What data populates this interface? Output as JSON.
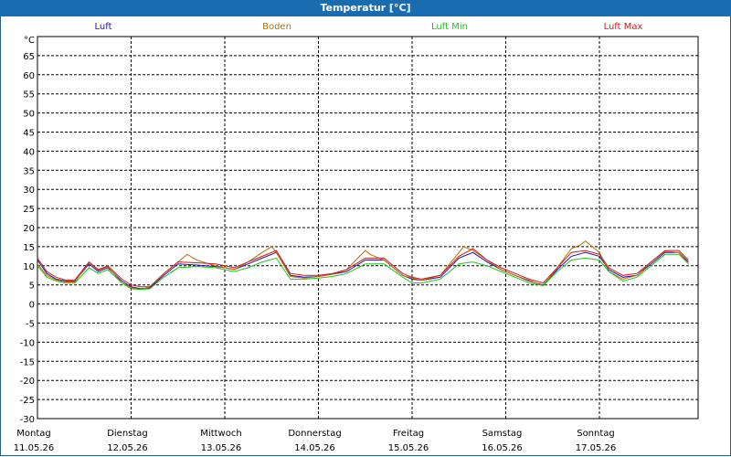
{
  "window": {
    "title": "Temperatur [°C]"
  },
  "colors": {
    "titlebar": "#1a6cb0",
    "grid": "#000000",
    "background": "#ffffff"
  },
  "chart_data": {
    "type": "line",
    "title": "Temperatur [°C]",
    "yunit": "°C",
    "ylim": [
      -30,
      70
    ],
    "yticks": [
      65,
      60,
      55,
      50,
      45,
      40,
      35,
      30,
      25,
      20,
      15,
      10,
      5,
      0,
      -5,
      -10,
      -15,
      -20,
      -25,
      -30
    ],
    "xlim": [
      0,
      7
    ],
    "grid": true,
    "legend_position": "top",
    "xticks": [
      {
        "x": 0,
        "day": "Montag",
        "date": "11.05.26"
      },
      {
        "x": 1,
        "day": "Dienstag",
        "date": "12.05.26"
      },
      {
        "x": 2,
        "day": "Mittwoch",
        "date": "13.05.26"
      },
      {
        "x": 3,
        "day": "Donnerstag",
        "date": "14.05.26"
      },
      {
        "x": 4,
        "day": "Freitag",
        "date": "15.05.26"
      },
      {
        "x": 5,
        "day": "Samstag",
        "date": "16.05.26"
      },
      {
        "x": 6,
        "day": "Sonntag",
        "date": "17.05.26"
      }
    ],
    "series": [
      {
        "name": "Luft",
        "color": "#1818a0",
        "x": [
          0,
          0.1,
          0.2,
          0.3,
          0.4,
          0.55,
          0.65,
          0.75,
          0.9,
          1.0,
          1.1,
          1.2,
          1.35,
          1.5,
          1.7,
          1.9,
          2.0,
          2.1,
          2.25,
          2.4,
          2.55,
          2.7,
          2.85,
          3.0,
          3.15,
          3.3,
          3.5,
          3.7,
          3.9,
          4.0,
          4.1,
          4.3,
          4.5,
          4.65,
          4.8,
          4.95,
          5.1,
          5.25,
          5.4,
          5.55,
          5.7,
          5.85,
          6.0,
          6.1,
          6.25,
          6.4,
          6.55,
          6.7,
          6.85,
          6.95
        ],
        "y": [
          11.5,
          8.0,
          6.5,
          6.0,
          6.0,
          10.5,
          8.5,
          9.5,
          6.0,
          4.5,
          4.0,
          4.2,
          7.5,
          10.5,
          10.2,
          9.8,
          9.5,
          9.0,
          10.5,
          12.0,
          13.5,
          7.5,
          7.0,
          7.2,
          7.8,
          8.5,
          11.5,
          11.5,
          7.5,
          6.5,
          6.2,
          7.0,
          12.0,
          13.5,
          11.0,
          9.0,
          7.5,
          6.0,
          5.0,
          9.0,
          12.5,
          13.5,
          12.5,
          9.0,
          7.0,
          7.5,
          10.5,
          13.5,
          13.5,
          11.0
        ]
      },
      {
        "name": "Boden",
        "color": "#b87000",
        "x": [
          0,
          0.1,
          0.2,
          0.3,
          0.4,
          0.55,
          0.65,
          0.75,
          0.9,
          1.0,
          1.1,
          1.2,
          1.35,
          1.5,
          1.6,
          1.7,
          1.9,
          2.0,
          2.1,
          2.25,
          2.4,
          2.5,
          2.55,
          2.7,
          2.85,
          3.0,
          3.15,
          3.3,
          3.5,
          3.55,
          3.7,
          3.9,
          4.0,
          4.1,
          4.3,
          4.5,
          4.55,
          4.65,
          4.8,
          4.95,
          5.1,
          5.25,
          5.4,
          5.55,
          5.7,
          5.8,
          5.85,
          6.0,
          6.1,
          6.25,
          6.4,
          6.55,
          6.7,
          6.85,
          6.95
        ],
        "y": [
          10.5,
          7.5,
          6.3,
          5.8,
          5.8,
          11.0,
          8.8,
          9.8,
          5.5,
          4.3,
          3.8,
          4.5,
          8.0,
          11.0,
          13.0,
          11.5,
          10.0,
          9.5,
          9.0,
          11.0,
          13.5,
          15.0,
          13.5,
          7.2,
          6.8,
          7.2,
          7.8,
          9.0,
          14.0,
          13.0,
          11.5,
          7.5,
          6.8,
          6.2,
          7.5,
          13.5,
          15.0,
          14.0,
          11.5,
          9.0,
          7.5,
          6.2,
          4.8,
          9.5,
          14.5,
          15.5,
          16.5,
          13.5,
          8.5,
          6.5,
          7.5,
          11.0,
          13.8,
          13.5,
          10.5
        ]
      },
      {
        "name": "Luft Min",
        "color": "#20c020",
        "x": [
          0,
          0.1,
          0.2,
          0.3,
          0.4,
          0.55,
          0.65,
          0.75,
          0.9,
          1.0,
          1.1,
          1.2,
          1.35,
          1.5,
          1.7,
          1.9,
          2.0,
          2.1,
          2.25,
          2.4,
          2.55,
          2.7,
          2.85,
          3.0,
          3.15,
          3.3,
          3.5,
          3.7,
          3.9,
          4.0,
          4.1,
          4.3,
          4.5,
          4.65,
          4.8,
          4.95,
          5.1,
          5.25,
          5.4,
          5.55,
          5.7,
          5.85,
          6.0,
          6.1,
          6.25,
          6.4,
          6.55,
          6.7,
          6.85,
          6.95
        ],
        "y": [
          10.0,
          7.0,
          6.0,
          5.5,
          5.5,
          9.5,
          8.0,
          9.0,
          5.5,
          4.0,
          3.8,
          4.0,
          7.0,
          9.5,
          9.8,
          9.5,
          9.0,
          8.5,
          9.5,
          11.0,
          12.0,
          6.5,
          6.5,
          6.8,
          7.2,
          8.0,
          10.5,
          10.5,
          7.0,
          5.5,
          5.5,
          6.5,
          10.5,
          11.0,
          10.0,
          8.5,
          7.0,
          5.5,
          4.8,
          8.5,
          11.5,
          12.0,
          11.5,
          8.5,
          6.0,
          7.0,
          10.0,
          13.0,
          13.0,
          10.5
        ]
      },
      {
        "name": "Luft Max",
        "color": "#d01818",
        "x": [
          0,
          0.1,
          0.2,
          0.3,
          0.4,
          0.55,
          0.65,
          0.75,
          0.9,
          1.0,
          1.1,
          1.2,
          1.35,
          1.5,
          1.7,
          1.9,
          2.0,
          2.1,
          2.25,
          2.4,
          2.55,
          2.7,
          2.85,
          3.0,
          3.15,
          3.3,
          3.5,
          3.7,
          3.9,
          4.0,
          4.1,
          4.3,
          4.5,
          4.65,
          4.8,
          4.95,
          5.1,
          5.25,
          5.4,
          5.55,
          5.7,
          5.85,
          6.0,
          6.1,
          6.25,
          6.4,
          6.55,
          6.7,
          6.85,
          6.95
        ],
        "y": [
          12.0,
          8.5,
          7.0,
          6.3,
          6.3,
          11.0,
          9.0,
          10.0,
          6.5,
          5.0,
          4.5,
          4.5,
          8.0,
          11.0,
          10.8,
          10.5,
          10.0,
          9.5,
          11.0,
          12.5,
          14.0,
          8.0,
          7.5,
          7.5,
          8.0,
          9.0,
          12.0,
          12.0,
          8.0,
          7.0,
          6.5,
          7.5,
          12.5,
          14.5,
          11.5,
          9.5,
          8.0,
          6.5,
          5.5,
          9.5,
          13.5,
          14.0,
          13.0,
          9.5,
          7.5,
          8.0,
          11.0,
          14.0,
          14.0,
          11.5
        ]
      }
    ]
  }
}
